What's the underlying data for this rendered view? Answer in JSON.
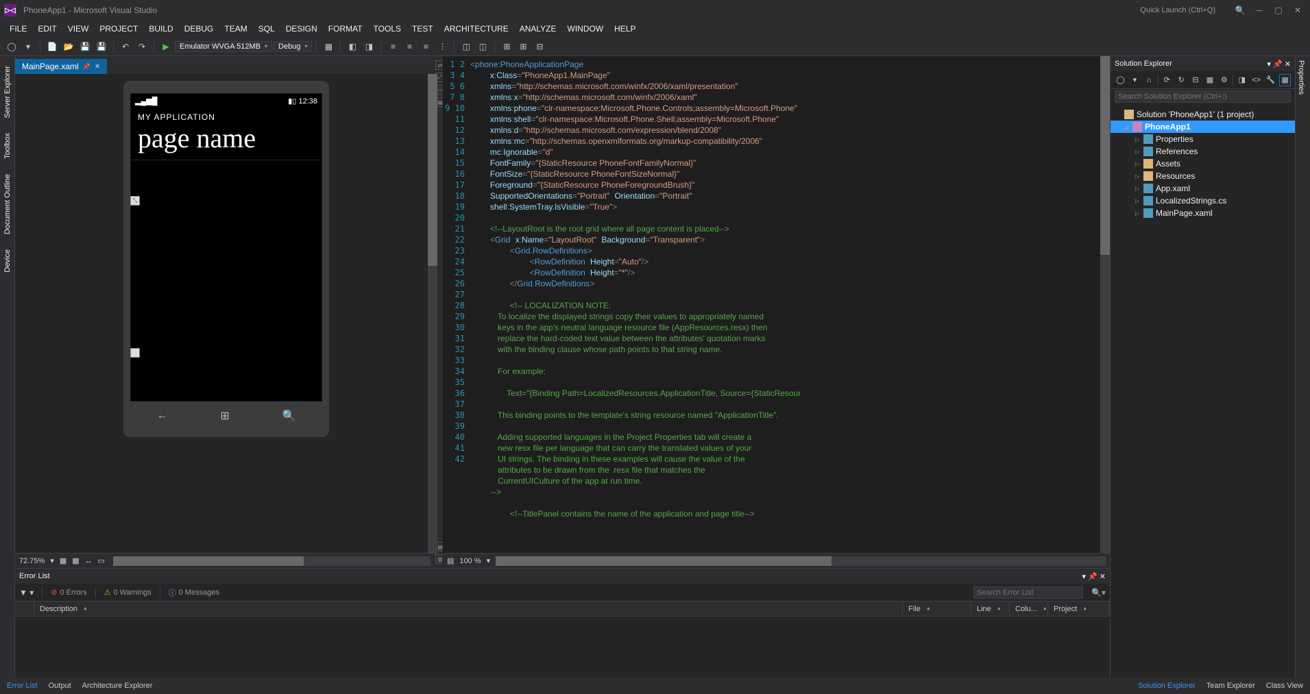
{
  "titlebar": {
    "title": "PhoneApp1 - Microsoft Visual Studio",
    "quick_launch": "Quick Launch (Ctrl+Q)"
  },
  "menu": [
    "FILE",
    "EDIT",
    "VIEW",
    "PROJECT",
    "BUILD",
    "DEBUG",
    "TEAM",
    "SQL",
    "DESIGN",
    "FORMAT",
    "TOOLS",
    "TEST",
    "ARCHITECTURE",
    "ANALYZE",
    "WINDOW",
    "HELP"
  ],
  "toolbar": {
    "run_target": "Emulator WVGA 512MB",
    "config": "Debug"
  },
  "tabs": {
    "active": "MainPage.xaml"
  },
  "designer": {
    "zoom": "72.75%",
    "phone": {
      "time": "12:38",
      "app_title": "MY APPLICATION",
      "page_name": "page name"
    }
  },
  "code": {
    "zoom": "100 %",
    "lines": [
      {
        "n": 1,
        "html": "<span class='c-punc'>&lt;</span><span class='c-elem'>phone</span><span class='c-punc'>:</span><span class='c-elem'>PhoneApplicationPage</span>"
      },
      {
        "n": 2,
        "html": "    <span class='c-attr'>x</span><span class='c-punc'>:</span><span class='c-attr'>Class</span><span class='c-punc'>=</span><span class='c-str'>\"PhoneApp1.MainPage\"</span>"
      },
      {
        "n": 3,
        "html": "    <span class='c-attr'>xmlns</span><span class='c-punc'>=</span><span class='c-str'>\"http://schemas.microsoft.com/winfx/2006/xaml/presentation\"</span>"
      },
      {
        "n": 4,
        "html": "    <span class='c-attr'>xmlns</span><span class='c-punc'>:</span><span class='c-attr'>x</span><span class='c-punc'>=</span><span class='c-str'>\"http://schemas.microsoft.com/winfx/2006/xaml\"</span>"
      },
      {
        "n": 5,
        "html": "    <span class='c-attr'>xmlns</span><span class='c-punc'>:</span><span class='c-attr'>phone</span><span class='c-punc'>=</span><span class='c-str'>\"clr-namespace:Microsoft.Phone.Controls;assembly=Microsoft.Phone\"</span>"
      },
      {
        "n": 6,
        "html": "    <span class='c-attr'>xmlns</span><span class='c-punc'>:</span><span class='c-attr'>shell</span><span class='c-punc'>=</span><span class='c-str'>\"clr-namespace:Microsoft.Phone.Shell;assembly=Microsoft.Phone\"</span>"
      },
      {
        "n": 7,
        "html": "    <span class='c-attr'>xmlns</span><span class='c-punc'>:</span><span class='c-attr'>d</span><span class='c-punc'>=</span><span class='c-str'>\"http://schemas.microsoft.com/expression/blend/2008\"</span>"
      },
      {
        "n": 8,
        "html": "    <span class='c-attr'>xmlns</span><span class='c-punc'>:</span><span class='c-attr'>mc</span><span class='c-punc'>=</span><span class='c-str'>\"http://schemas.openxmlformats.org/markup-compatibility/2006\"</span>"
      },
      {
        "n": 9,
        "html": "    <span class='c-attr'>mc</span><span class='c-punc'>:</span><span class='c-attr'>Ignorable</span><span class='c-punc'>=</span><span class='c-str'>\"d\"</span>"
      },
      {
        "n": 10,
        "html": "    <span class='c-attr'>FontFamily</span><span class='c-punc'>=</span><span class='c-str'>\"{StaticResource PhoneFontFamilyNormal}\"</span>"
      },
      {
        "n": 11,
        "html": "    <span class='c-attr'>FontSize</span><span class='c-punc'>=</span><span class='c-str'>\"{StaticResource PhoneFontSizeNormal}\"</span>"
      },
      {
        "n": 12,
        "html": "    <span class='c-attr'>Foreground</span><span class='c-punc'>=</span><span class='c-str'>\"{StaticResource PhoneForegroundBrush}\"</span>"
      },
      {
        "n": 13,
        "html": "    <span class='c-attr'>SupportedOrientations</span><span class='c-punc'>=</span><span class='c-str'>\"Portrait\"</span> <span class='c-attr'>Orientation</span><span class='c-punc'>=</span><span class='c-str'>\"Portrait\"</span>"
      },
      {
        "n": 14,
        "html": "    <span class='c-attr'>shell</span><span class='c-punc'>:</span><span class='c-attr'>SystemTray.IsVisible</span><span class='c-punc'>=</span><span class='c-str'>\"True\"</span><span class='c-punc'>&gt;</span>"
      },
      {
        "n": 15,
        "html": ""
      },
      {
        "n": 16,
        "html": "    <span class='c-cmt'>&lt;!--LayoutRoot is the root grid where all page content is placed--&gt;</span>"
      },
      {
        "n": 17,
        "html": "    <span class='c-punc'>&lt;</span><span class='c-elem'>Grid</span> <span class='c-attr'>x</span><span class='c-punc'>:</span><span class='c-attr'>Name</span><span class='c-punc'>=</span><span class='c-str'>\"LayoutRoot\"</span> <span class='c-attr'>Background</span><span class='c-punc'>=</span><span class='c-str'>\"Transparent\"</span><span class='c-punc'>&gt;</span>"
      },
      {
        "n": 18,
        "html": "        <span class='c-punc'>&lt;</span><span class='c-elem'>Grid.RowDefinitions</span><span class='c-punc'>&gt;</span>"
      },
      {
        "n": 19,
        "html": "            <span class='c-punc'>&lt;</span><span class='c-elem'>RowDefinition</span> <span class='c-attr'>Height</span><span class='c-punc'>=</span><span class='c-str'>\"Auto\"</span><span class='c-punc'>/&gt;</span>"
      },
      {
        "n": 20,
        "html": "            <span class='c-punc'>&lt;</span><span class='c-elem'>RowDefinition</span> <span class='c-attr'>Height</span><span class='c-punc'>=</span><span class='c-str'>\"*\"</span><span class='c-punc'>/&gt;</span>"
      },
      {
        "n": 21,
        "html": "        <span class='c-punc'>&lt;/</span><span class='c-elem'>Grid.RowDefinitions</span><span class='c-punc'>&gt;</span>"
      },
      {
        "n": 22,
        "html": ""
      },
      {
        "n": 23,
        "html": "        <span class='c-cmt'>&lt;!-- LOCALIZATION NOTE:</span>"
      },
      {
        "n": 24,
        "html": "<span class='c-cmt'>            To localize the displayed strings copy their values to appropriately named</span>"
      },
      {
        "n": 25,
        "html": "<span class='c-cmt'>            keys in the app's neutral language resource file (AppResources.resx) then</span>"
      },
      {
        "n": 26,
        "html": "<span class='c-cmt'>            replace the hard-coded text value between the attributes' quotation marks</span>"
      },
      {
        "n": 27,
        "html": "<span class='c-cmt'>            with the binding clause whose path points to that string name.</span>"
      },
      {
        "n": 28,
        "html": ""
      },
      {
        "n": 29,
        "html": "<span class='c-cmt'>            For example:</span>"
      },
      {
        "n": 30,
        "html": ""
      },
      {
        "n": 31,
        "html": "<span class='c-cmt'>                Text=\"{Binding Path=LocalizedResources.ApplicationTitle, Source={StaticResour</span>"
      },
      {
        "n": 32,
        "html": ""
      },
      {
        "n": 33,
        "html": "<span class='c-cmt'>            This binding points to the template's string resource named \"ApplicationTitle\".</span>"
      },
      {
        "n": 34,
        "html": ""
      },
      {
        "n": 35,
        "html": "<span class='c-cmt'>            Adding supported languages in the Project Properties tab will create a</span>"
      },
      {
        "n": 36,
        "html": "<span class='c-cmt'>            new resx file per language that can carry the translated values of your</span>"
      },
      {
        "n": 37,
        "html": "<span class='c-cmt'>            UI strings. The binding in these examples will cause the value of the</span>"
      },
      {
        "n": 38,
        "html": "<span class='c-cmt'>            attributes to be drawn from the .resx file that matches the</span>"
      },
      {
        "n": 39,
        "html": "<span class='c-cmt'>            CurrentUICulture of the app at run time.</span>"
      },
      {
        "n": 40,
        "html": "<span class='c-cmt'>         --&gt;</span>"
      },
      {
        "n": 41,
        "html": ""
      },
      {
        "n": 42,
        "html": "        <span class='c-cmt'>&lt;!--TitlePanel contains the name of the application and page title--&gt;</span>"
      }
    ]
  },
  "solution_explorer": {
    "title": "Solution Explorer",
    "search_placeholder": "Search Solution Explorer (Ctrl+;)",
    "root": "Solution 'PhoneApp1' (1 project)",
    "project": "PhoneApp1",
    "nodes": [
      "Properties",
      "References",
      "Assets",
      "Resources",
      "App.xaml",
      "LocalizedStrings.cs",
      "MainPage.xaml"
    ]
  },
  "error_list": {
    "title": "Error List",
    "errors": "0 Errors",
    "warnings": "0 Warnings",
    "messages": "0 Messages",
    "search_placeholder": "Search Error List",
    "columns": {
      "desc": "Description",
      "file": "File",
      "line": "Line",
      "col": "Colu...",
      "project": "Project"
    }
  },
  "statusbar": {
    "left": [
      "Error List",
      "Output",
      "Architecture Explorer"
    ],
    "right": [
      "Solution Explorer",
      "Team Explorer",
      "Class View"
    ]
  },
  "right_rail": "Properties",
  "left_rail": [
    "Server Explorer",
    "Toolbox",
    "Document Outline",
    "Device"
  ]
}
